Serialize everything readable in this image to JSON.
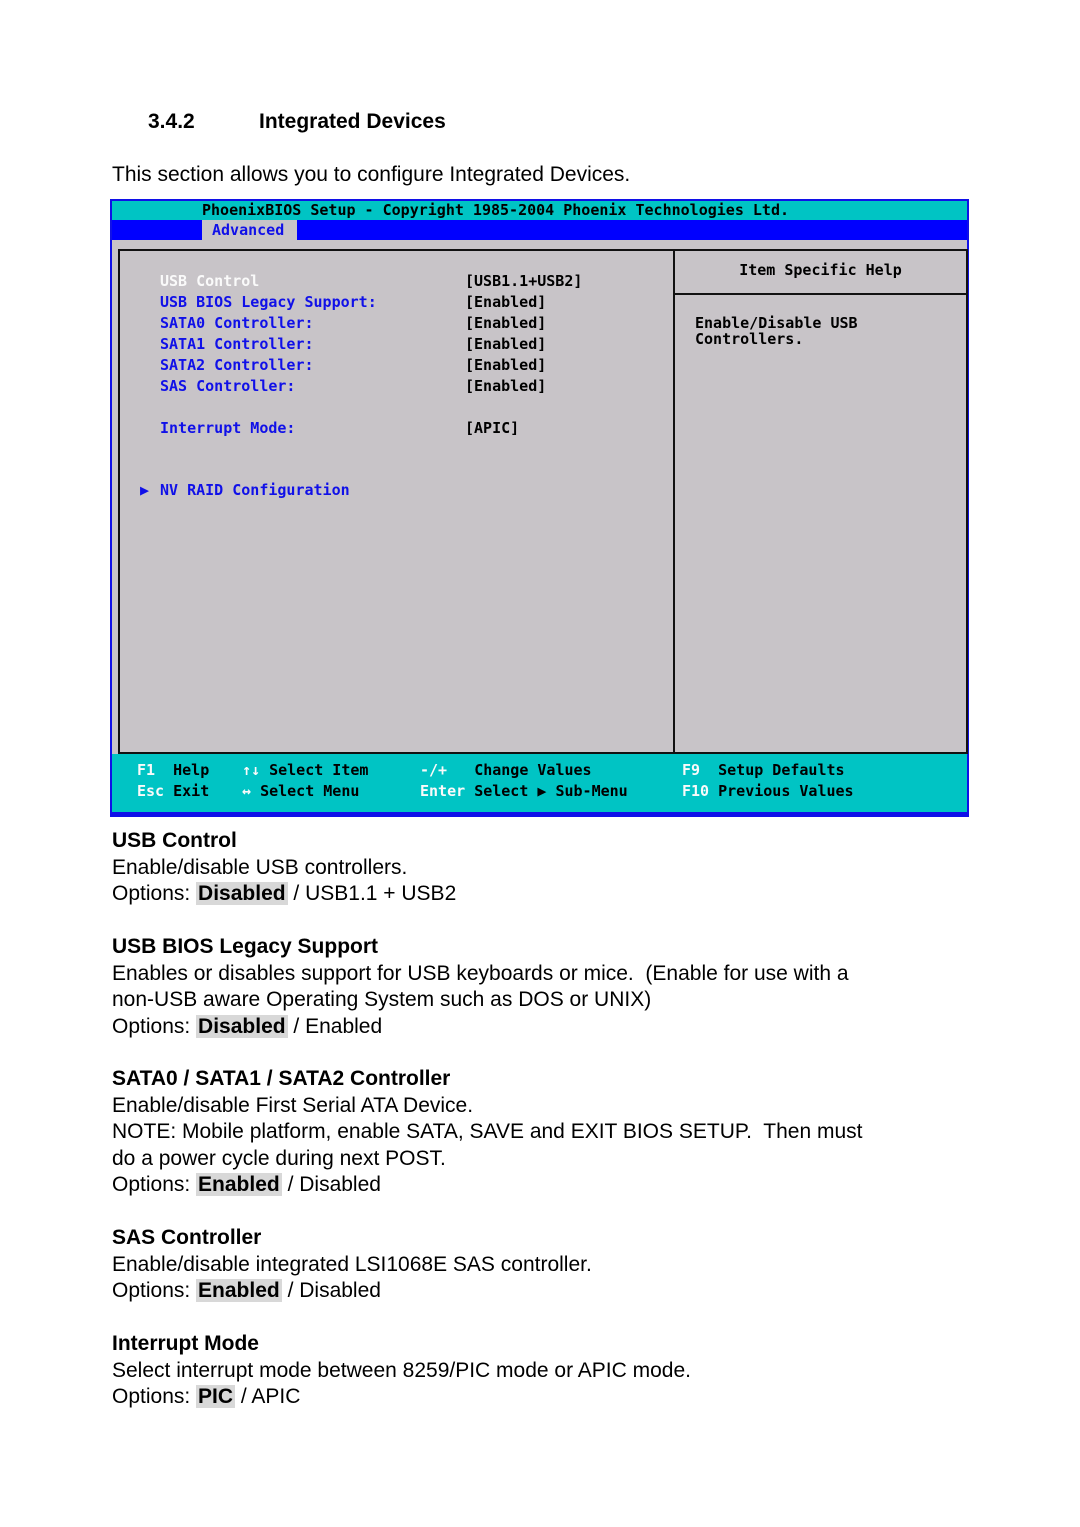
{
  "section": {
    "number": "3.4.2",
    "title": "Integrated Devices",
    "intro": "This section allows you to configure Integrated Devices."
  },
  "bios": {
    "title": "PhoenixBIOS Setup - Copyright 1985-2004 Phoenix Technologies Ltd.",
    "active_tab": "Advanced",
    "items": [
      {
        "label": "USB Control",
        "value": "[USB1.1+USB2]",
        "selected": true
      },
      {
        "label": "USB BIOS Legacy Support:",
        "value": "[Enabled]"
      },
      {
        "label": "SATA0 Controller:",
        "value": "[Enabled]"
      },
      {
        "label": "SATA1 Controller:",
        "value": "[Enabled]"
      },
      {
        "label": "SATA2 Controller:",
        "value": "[Enabled]"
      },
      {
        "label": "SAS Controller:",
        "value": "[Enabled]"
      },
      {
        "label": "Interrupt Mode:",
        "value": "[APIC]"
      }
    ],
    "submenu": {
      "icon": "triangle-right-icon",
      "label": "NV RAID Configuration"
    },
    "help": {
      "heading": "Item Specific Help",
      "text": "Enable/Disable USB\nControllers."
    },
    "footer": {
      "row1": [
        {
          "key": "F1",
          "text": "Help"
        },
        {
          "key": "↑↓",
          "text": "Select Item"
        },
        {
          "key": "-/+",
          "text": "Change Values"
        },
        {
          "key": "F9",
          "text": "Setup Defaults"
        }
      ],
      "row2": [
        {
          "key": "Esc",
          "text": "Exit"
        },
        {
          "key": "↔",
          "text": "Select Menu"
        },
        {
          "key": "Enter",
          "text": "Select ▶ Sub-Menu"
        },
        {
          "key": "F10",
          "text": "Previous Values"
        }
      ]
    }
  },
  "descriptions": [
    {
      "heading": "USB Control",
      "lines": [
        "Enable/disable USB controllers."
      ],
      "options_prefix": "Options: ",
      "default_option": "Disabled",
      "other_options": " / USB1.1 + USB2"
    },
    {
      "heading": "USB BIOS Legacy Support",
      "lines": [
        "Enables or disables support for USB keyboards or mice.  (Enable for use with a",
        "non-USB aware Operating System such as DOS or UNIX)"
      ],
      "options_prefix": "Options: ",
      "default_option": "Disabled",
      "other_options": " / Enabled"
    },
    {
      "heading": "SATA0 / SATA1 / SATA2 Controller",
      "lines": [
        "Enable/disable First Serial ATA Device.",
        "NOTE: Mobile platform, enable SATA, SAVE and EXIT BIOS SETUP.  Then must",
        "do a power cycle during next POST."
      ],
      "options_prefix": "Options: ",
      "default_option": "Enabled",
      "other_options": " / Disabled"
    },
    {
      "heading": "SAS Controller",
      "lines": [
        "Enable/disable integrated LSI1068E SAS controller."
      ],
      "options_prefix": "Options: ",
      "default_option": "Enabled",
      "other_options": " / Disabled"
    },
    {
      "heading": "Interrupt Mode",
      "lines": [
        "Select interrupt mode between 8259/PIC mode or APIC mode."
      ],
      "options_prefix": "Options: ",
      "default_option": "PIC",
      "other_options": " / APIC"
    }
  ]
}
